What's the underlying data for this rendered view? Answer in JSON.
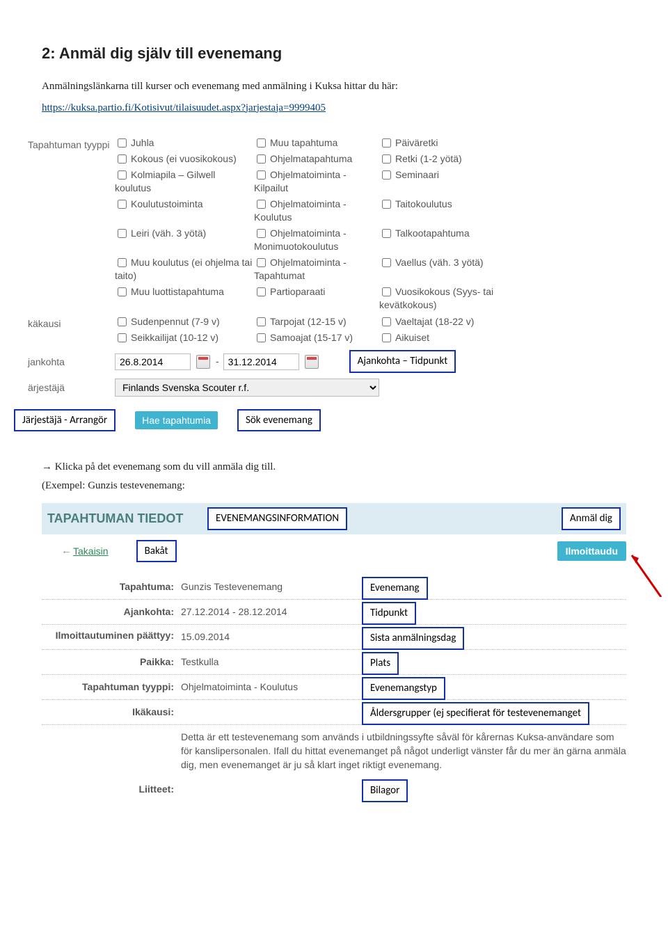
{
  "title": "2: Anmäl dig själv till evenemang",
  "intro_text": "Anmälningslänkarna till kurser och evenemang med anmälning i Kuksa hittar du här:",
  "intro_link": "https://kuksa.partio.fi/Kotisivut/tilaisuudet.aspx?jarjestaja=9999405",
  "filter": {
    "type_label": "Tapahtuman tyyppi",
    "type_options_col1": [
      "Juhla",
      "Kokous (ei vuosikokous)",
      "Kolmiapila – Gilwell koulutus",
      "Koulutustoiminta",
      "Leiri (väh. 3 yötä)",
      "Muu koulutus (ei ohjelma tai taito)",
      "Muu luottistapahtuma"
    ],
    "type_options_col2": [
      "Muu tapahtuma",
      "Ohjelmatapahtuma",
      "Ohjelmatoiminta - Kilpailut",
      "Ohjelmatoiminta - Koulutus",
      "Ohjelmatoiminta - Monimuotokoulutus",
      "Ohjelmatoiminta - Tapahtumat",
      "Partioparaati"
    ],
    "type_options_col3": [
      "Päiväretki",
      "Retki (1-2 yötä)",
      "Seminaari",
      "Taitokoulutus",
      "Talkootapahtuma",
      "Vaellus (väh. 3 yötä)",
      "Vuosikokous (Syys- tai kevätkokous)"
    ],
    "age_label": "käkausi",
    "age_options_col1": [
      "Sudenpennut (7-9 v)",
      "Seikkailijat (10-12 v)"
    ],
    "age_options_col2": [
      "Tarpojat (12-15 v)",
      "Samoajat (15-17 v)"
    ],
    "age_options_col3": [
      "Vaeltajat (18-22 v)",
      "Aikuiset"
    ],
    "date_label": "jankohta",
    "date_from": "26.8.2014",
    "date_to": "31.12.2014",
    "date_annotation": "Ajankohta – Tidpunkt",
    "org_label": "ärjestäjä",
    "org_value": "Finlands Svenska Scouter r.f.",
    "org_annotation": "Järjestäjä - Arrangör",
    "search_button": "Hae tapahtumia",
    "search_annotation": "Sök evenemang"
  },
  "instruction_line": "Klicka på det evenemang som du vill anmäla dig till.",
  "example_line": "(Exempel: Gunzis testevenemang:",
  "details": {
    "header": "TAPAHTUMAN TIEDOT",
    "header_annotation": "EVENEMANGSINFORMATION",
    "anmal_annotation": "Anmäl dig",
    "back_link": "Takaisin",
    "back_annotation": "Bakåt",
    "ilmo_button": "Ilmoittaudu",
    "fields": {
      "event_k": "Tapahtuma:",
      "event_v": "Gunzis Testevenemang",
      "event_a": "Evenemang",
      "time_k": "Ajankohta:",
      "time_v": "27.12.2014 - 28.12.2014",
      "time_a": "Tidpunkt",
      "deadline_k": "Ilmoittautuminen päättyy:",
      "deadline_v": "15.09.2014",
      "deadline_a": "Sista anmälningsdag",
      "place_k": "Paikka:",
      "place_v": "Testkulla",
      "place_a": "Plats",
      "type_k": "Tapahtuman tyyppi:",
      "type_v": "Ohjelmatoiminta - Koulutus",
      "type_a": "Evenemangstyp",
      "ika_k": "Ikäkausi:",
      "ika_a": "Åldersgrupper (ej specifierat för testevenemanget",
      "desc": "Detta är ett testevenemang som används i utbildningssyfte såväl för kårernas Kuksa-användare som för kanslipersonalen. Ifall du hittat evenemanget på något underligt vänster får du mer än gärna anmäla dig, men evenemanget är ju så klart inget riktigt evenemang.",
      "att_k": "Liitteet:",
      "att_a": "Bilagor"
    }
  }
}
